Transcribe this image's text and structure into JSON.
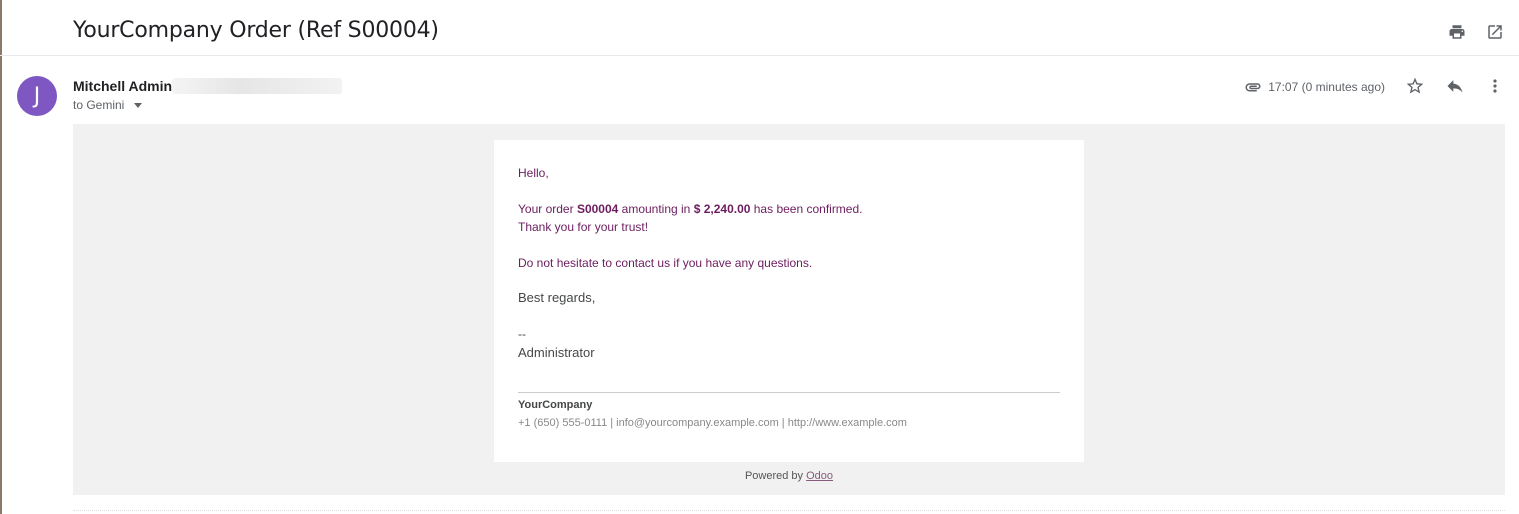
{
  "subject": "YourCompany Order (Ref S00004)",
  "sender": {
    "name": "Mitchell Admin",
    "avatar_letter": "J",
    "avatar_color": "#7e57c2",
    "to_label": "to Gemini"
  },
  "meta": {
    "time": "17:07 (0 minutes ago)"
  },
  "icons": {
    "print": "print-icon",
    "open_new": "open-in-new-icon",
    "attachment": "paperclip-icon",
    "star": "star-icon",
    "reply": "reply-icon",
    "more": "more-vert-icon"
  },
  "message": {
    "greeting": "Hello,",
    "line1_pre": "Your order ",
    "order_ref": "S00004",
    "line1_mid": " amounting in ",
    "amount": "$ 2,240.00",
    "line1_post": " has been confirmed.",
    "line2": "Thank you for your trust!",
    "line3": "Do not hesitate to contact us if you have any questions.",
    "regards": "Best regards,",
    "sig_dash": "--",
    "sig_name": "Administrator",
    "company": "YourCompany",
    "contact": "+1 (650) 555-0111 | info@yourcompany.example.com | http://www.example.com",
    "powered_by": "Powered by ",
    "powered_link": "Odoo"
  },
  "colors": {
    "message_text": "#6c1d5f",
    "link": "#875a7b",
    "body_bg": "#f1f1f1"
  }
}
